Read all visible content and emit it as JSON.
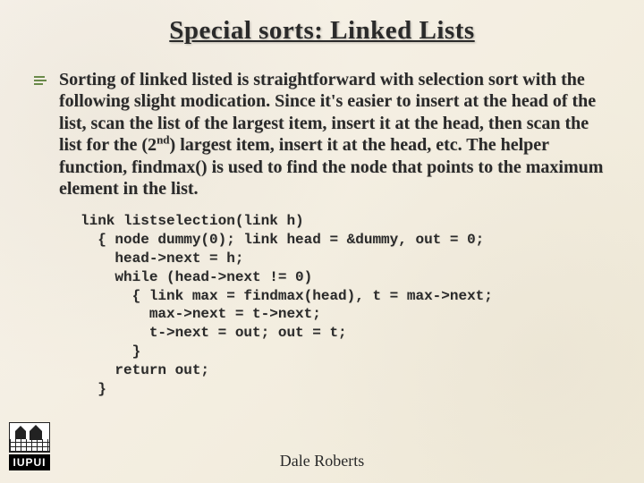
{
  "title": "Special sorts: Linked Lists",
  "body_html": "Sorting of linked listed is straightforward with selection sort with the following slight modication.  Since it's easier to insert at the head of the list, scan the list of the largest item, insert it at the head, then scan the list for the (2<sup>nd</sup>) largest item, insert it at the head, etc.  The helper function, findmax() is used to find the node that points to the maximum element in the list.",
  "code": "link listselection(link h)\n  { node dummy(0); link head = &dummy, out = 0;\n    head->next = h;\n    while (head->next != 0)\n      { link max = findmax(head), t = max->next;\n        max->next = t->next;\n        t->next = out; out = t;\n      }\n    return out;\n  }",
  "footer": {
    "author": "Dale Roberts"
  },
  "logo": {
    "text": "IUPUI"
  }
}
